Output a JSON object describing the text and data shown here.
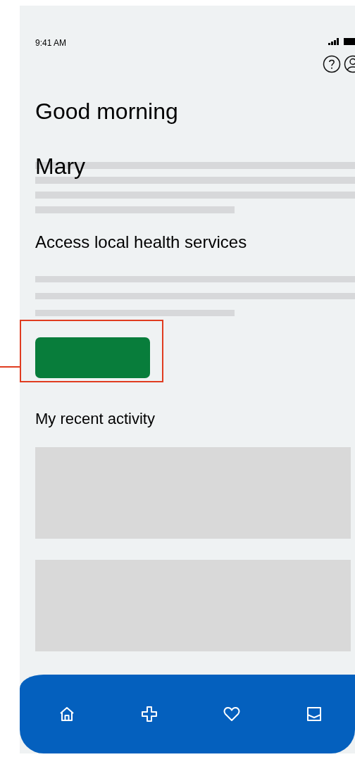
{
  "status_bar": {
    "time": "9:41 AM"
  },
  "greeting": "Good morning",
  "user_name": "Mary",
  "services": {
    "heading": "Access local health services"
  },
  "activity": {
    "heading": "My recent activity"
  },
  "nav": {
    "items": [
      {
        "kind": "home"
      },
      {
        "kind": "plus"
      },
      {
        "kind": "heart"
      },
      {
        "kind": "inbox"
      }
    ]
  }
}
